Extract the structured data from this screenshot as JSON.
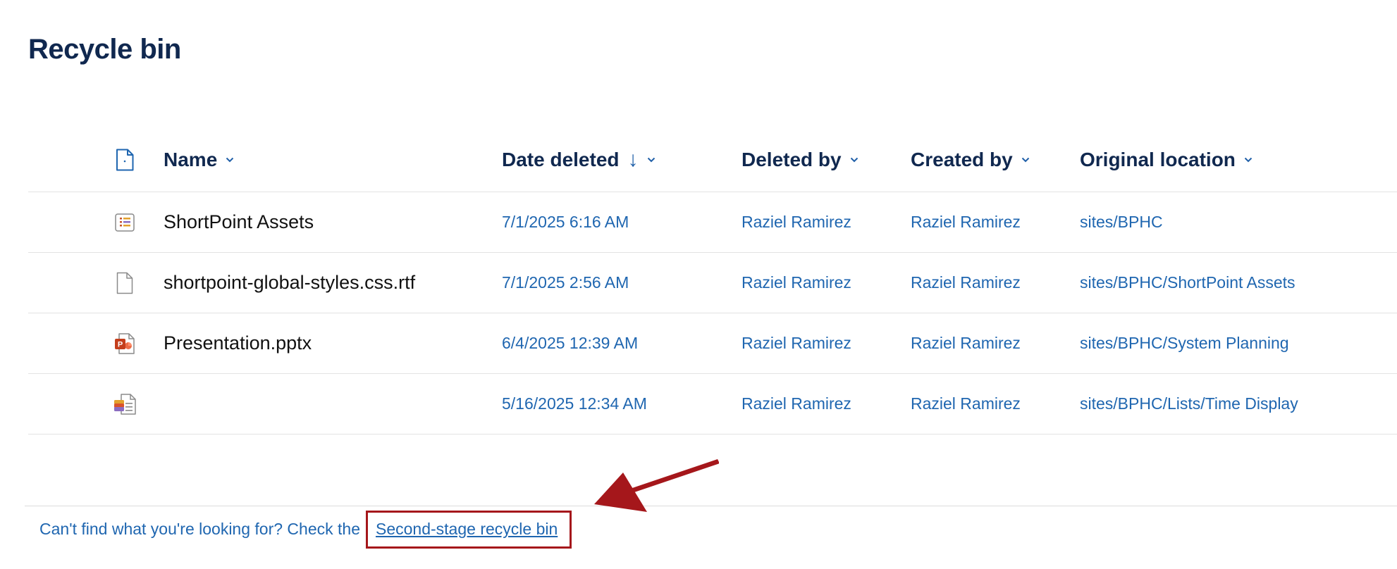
{
  "page": {
    "title": "Recycle bin"
  },
  "table": {
    "header": {
      "name": "Name",
      "date_deleted": "Date deleted",
      "sort_indicator": "↓",
      "deleted_by": "Deleted by",
      "created_by": "Created by",
      "original_location": "Original location"
    },
    "rows": [
      {
        "icon": "list-assets-icon",
        "name": "ShortPoint Assets",
        "date_deleted": "7/1/2025 6:16 AM",
        "deleted_by": "Raziel Ramirez",
        "created_by": "Raziel Ramirez",
        "original_location": "sites/BPHC"
      },
      {
        "icon": "document-icon",
        "name": "shortpoint-global-styles.css.rtf",
        "date_deleted": "7/1/2025 2:56 AM",
        "deleted_by": "Raziel Ramirez",
        "created_by": "Raziel Ramirez",
        "original_location": "sites/BPHC/ShortPoint Assets"
      },
      {
        "icon": "powerpoint-icon",
        "name": "Presentation.pptx",
        "date_deleted": "6/4/2025 12:39 AM",
        "deleted_by": "Raziel Ramirez",
        "created_by": "Raziel Ramirez",
        "original_location": "sites/BPHC/System Planning"
      },
      {
        "icon": "list-item-icon",
        "name": "",
        "date_deleted": "5/16/2025 12:34 AM",
        "deleted_by": "Raziel Ramirez",
        "created_by": "Raziel Ramirez",
        "original_location": "sites/BPHC/Lists/Time Display"
      }
    ]
  },
  "footer": {
    "message": "Can't find what you're looking for? Check the",
    "link_label": "Second-stage recycle bin"
  },
  "colors": {
    "title": "#10284f",
    "link": "#1f66b0",
    "annotation": "#a5171b"
  }
}
